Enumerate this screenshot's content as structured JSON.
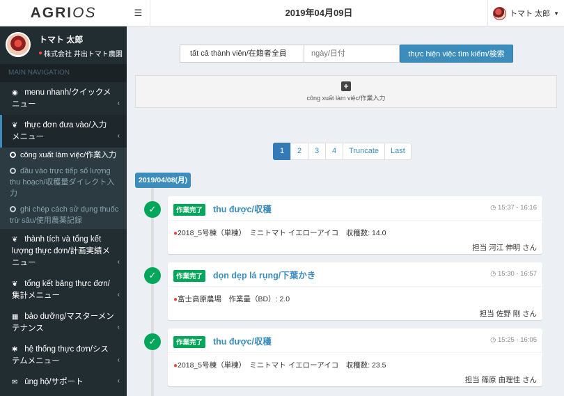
{
  "brand": {
    "logo_bold": "AGRI",
    "logo_italic": "OS"
  },
  "header": {
    "date": "2019年04月09日",
    "user_name": "トマト 太郎"
  },
  "sidebar": {
    "user_name": "トマト 太郎",
    "company": "株式会社 井出トマト農園",
    "nav_header": "MAIN NAVIGATION",
    "items": [
      {
        "label": "menu nhanh/クイックメニュー",
        "icon": "dashboard-icon"
      },
      {
        "label": "thực đơn đưa vào/入力メニュー",
        "icon": "leaf-icon",
        "sub": [
          {
            "label": "công xuất làm việc/作業入力",
            "active": true
          },
          {
            "label": "đầu vào trực tiếp số lượng thu hoạch/収穫量ダイレクト入力",
            "active": false
          },
          {
            "label": "ghi chép cách sử dụng thuốc trừ sâu/使用農薬記録",
            "active": false
          }
        ]
      },
      {
        "label": "thành tích và tổng kết lượng thực đơn/計画実績メニュー",
        "icon": "leaf-icon"
      },
      {
        "label": "tổng kết bảng thực đơn/集計メニュー",
        "icon": "leaf-icon"
      },
      {
        "label": "bảo dưỡng/マスターメンテナンス",
        "icon": "table-icon"
      },
      {
        "label": "hệ thống thực đơn/システムメニュー",
        "icon": "gear-icon"
      },
      {
        "label": "ủng hộ/サポート",
        "icon": "envelope-icon"
      }
    ]
  },
  "search": {
    "member_select": "tất cả thành viên/在籍者全員",
    "date_placeholder": "ngày/日付",
    "button": "thực hiện việc tìm kiếm/検索"
  },
  "add_work": {
    "label": "công xuất làm việc/作業入力"
  },
  "pagination": [
    "1",
    "2",
    "3",
    "4",
    "Truncate",
    "Last"
  ],
  "timeline": {
    "date": "2019/04/08(月)",
    "entries": [
      {
        "badge": "作業完了",
        "title": "thu được/収穫",
        "time": "15:37 - 16:16",
        "location": "2018_5号棟（単棟）　ミニトマト イエローアイコ　収穫数: 14.0",
        "assignee": "担当 河江 伸明 さん"
      },
      {
        "badge": "作業完了",
        "title": "dọn dẹp lá rụng/下葉かき",
        "time": "15:30 - 16:57",
        "location": "富士高原農場　作業量（BD）: 2.0",
        "assignee": "担当 佐野 剛 さん"
      },
      {
        "badge": "作業完了",
        "title": "thu được/収穫",
        "time": "15:25 - 16:05",
        "location": "2018_5号棟（単棟）　ミニトマト イエローアイコ　収穫数: 23.5",
        "assignee": "担当 篠原 由理佳 さん"
      }
    ]
  }
}
